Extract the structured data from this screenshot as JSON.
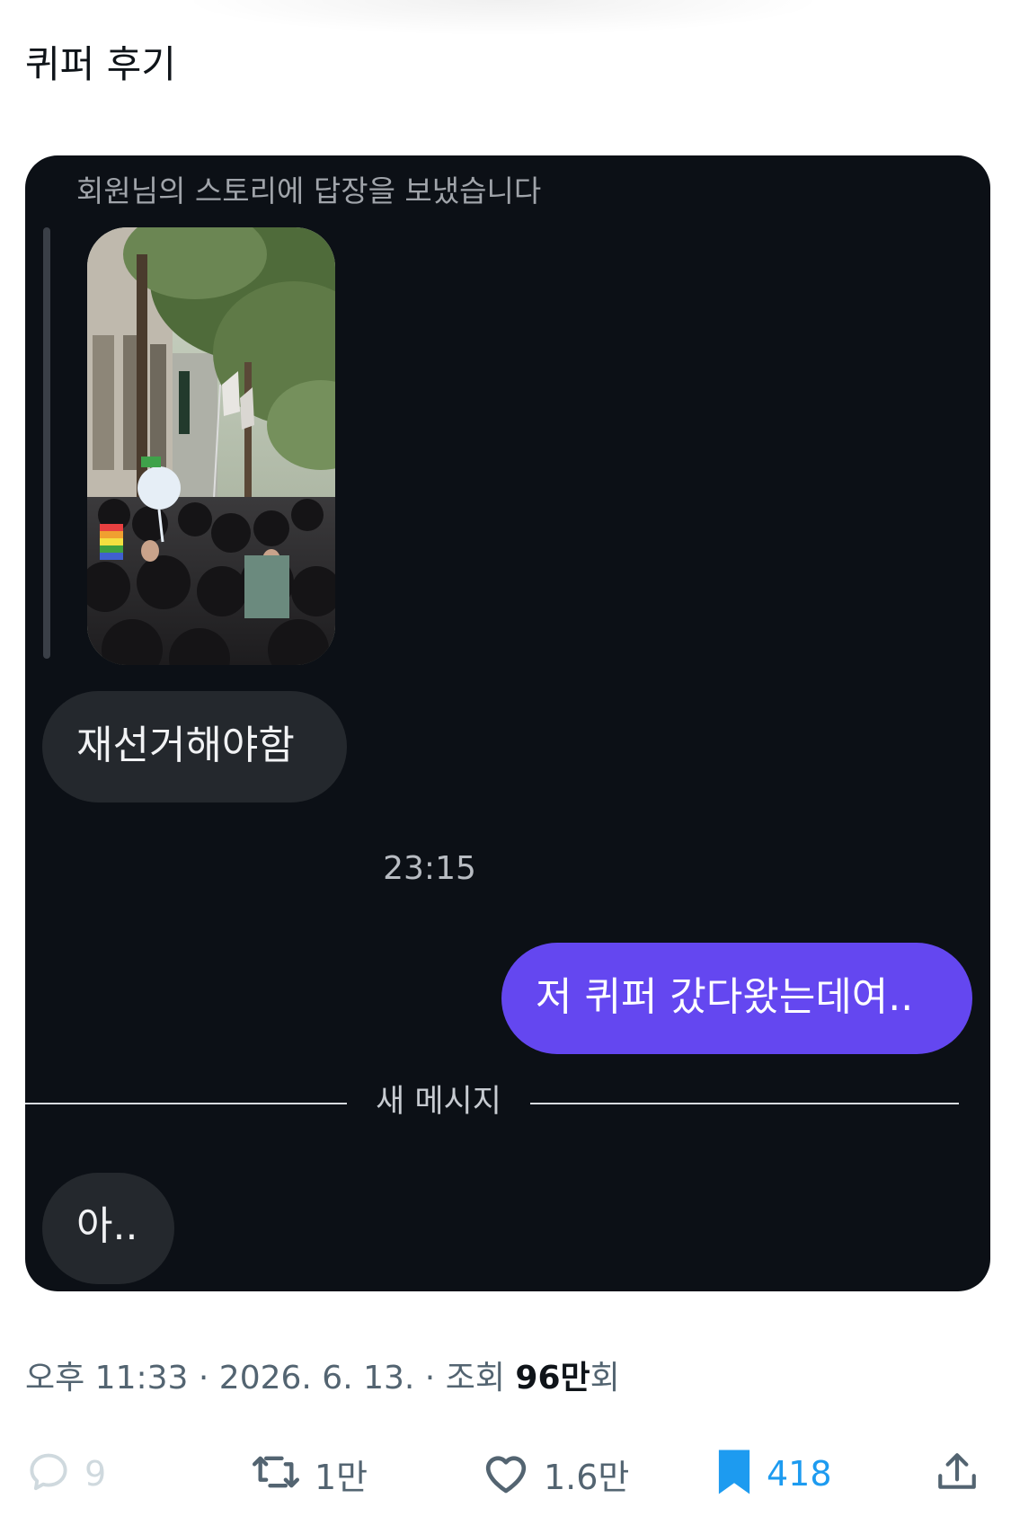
{
  "post": {
    "text": "퀴퍼 후기"
  },
  "dm": {
    "story_reply_label": "회원님의 스토리에 답장을 보냈습니다",
    "messages": [
      {
        "text": "재선거해야함"
      },
      {
        "text": "저 퀴퍼 갔다왔는데여.."
      },
      {
        "text": "아.."
      }
    ],
    "timestamp": "23:15",
    "new_messages_label": "새 메시지",
    "colors": {
      "background": "#0c1016",
      "incoming": "#24282d",
      "outgoing": "#6447f0"
    }
  },
  "meta": {
    "time": "오후 11:33",
    "separator": "·",
    "date": "2026. 6. 13.",
    "views_label": "조회",
    "views_count": "96만",
    "views_suffix": "회"
  },
  "actions": {
    "reply_count": "9",
    "retweet_count": "1만",
    "like_count": "1.6만",
    "bookmark_count": "418",
    "icons": [
      "reply-icon",
      "retweet-icon",
      "like-icon",
      "bookmark-icon",
      "share-icon"
    ]
  }
}
